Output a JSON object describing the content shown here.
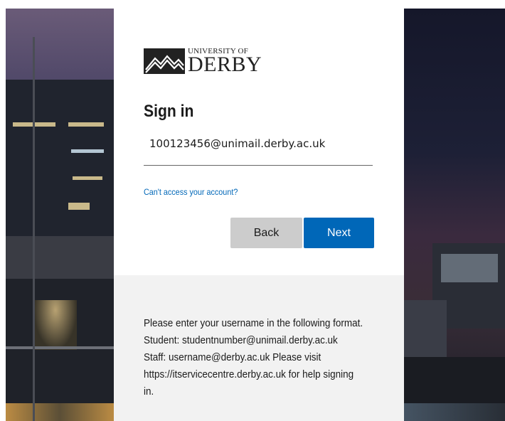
{
  "logo": {
    "line1": "UNIVERSITY OF",
    "line2": "DERBY"
  },
  "signin": {
    "title": "Sign in",
    "username_value": "100123456@unimail.derby.ac.uk",
    "cant_access_link": "Can't access your account?",
    "back_label": "Back",
    "next_label": "Next"
  },
  "help": {
    "line1": "Please enter your username in the following format.",
    "line2": "Student: studentnumber@unimail.derby.ac.uk",
    "line3": "Staff: username@derby.ac.uk Please visit",
    "line4": "https://itservicecentre.derby.ac.uk for help signing",
    "line5": "in."
  },
  "colors": {
    "accent": "#0067b8",
    "back_button": "#cccccc",
    "footer_bg": "#f2f2f2"
  }
}
